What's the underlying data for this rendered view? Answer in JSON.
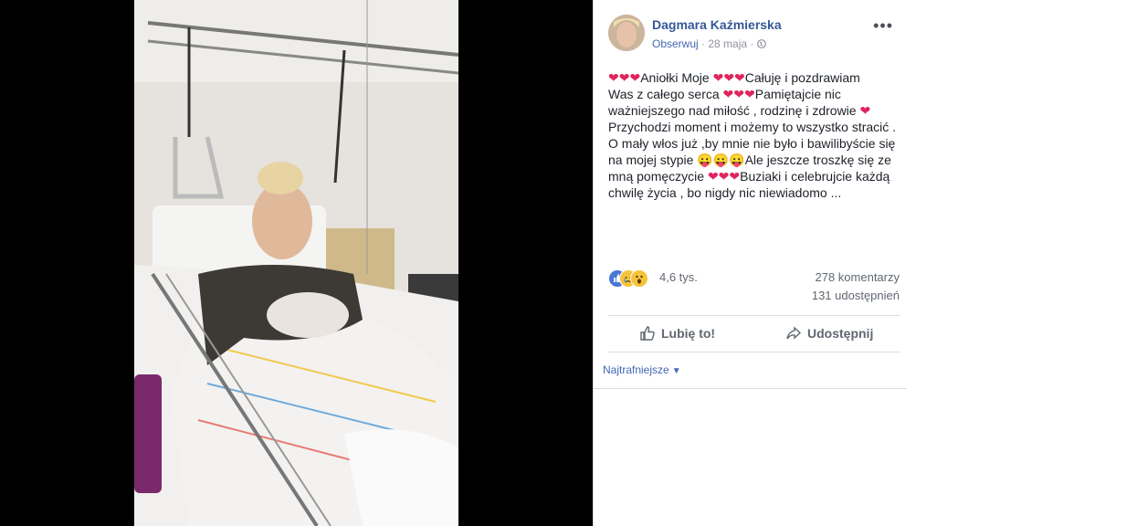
{
  "post": {
    "author": "Dagmara Kaźmierska",
    "follow_label": "Obserwuj",
    "date": "28 maja",
    "separator": " · ",
    "more_label": "•••",
    "text_lines": [
      {
        "parts": [
          {
            "t": "heart"
          },
          {
            "t": "heart"
          },
          {
            "t": "heart"
          },
          {
            "t": "text",
            "v": "Aniołki Moje "
          },
          {
            "t": "heart"
          },
          {
            "t": "heart"
          },
          {
            "t": "heart"
          },
          {
            "t": "text",
            "v": "Całuję i pozdrawiam"
          }
        ]
      },
      {
        "parts": [
          {
            "t": "text",
            "v": "Was z całego serca "
          },
          {
            "t": "heart"
          },
          {
            "t": "heart"
          },
          {
            "t": "heart"
          },
          {
            "t": "text",
            "v": "Pamiętajcie nic"
          }
        ]
      },
      {
        "parts": [
          {
            "t": "text",
            "v": "ważniejszego nad miłość , rodzinę i zdrowie "
          },
          {
            "t": "heart"
          }
        ]
      },
      {
        "parts": [
          {
            "t": "text",
            "v": "Przychodzi moment i możemy to wszystko stracić ."
          }
        ]
      },
      {
        "parts": [
          {
            "t": "text",
            "v": "O mały włos już ,by mnie nie było i bawilibyście się"
          }
        ]
      },
      {
        "parts": [
          {
            "t": "text",
            "v": "na mojej stypie "
          },
          {
            "t": "emoji",
            "v": "😛😛😛"
          },
          {
            "t": "text",
            "v": "Ale jeszcze troszkę się ze"
          }
        ]
      },
      {
        "parts": [
          {
            "t": "text",
            "v": "mną pomęczycie "
          },
          {
            "t": "heart"
          },
          {
            "t": "heart"
          },
          {
            "t": "heart"
          },
          {
            "t": "text",
            "v": "Buziaki i celebrujcie każdą"
          }
        ]
      },
      {
        "parts": [
          {
            "t": "text",
            "v": "chwilę życia , bo nigdy nic niewiadomo ..."
          }
        ]
      }
    ],
    "heart_glyph": "❤",
    "reactions": {
      "icons": [
        "like-icon",
        "sad-icon",
        "wow-icon"
      ],
      "count": "4,6 tys."
    },
    "comments_count": "278 komentarzy",
    "shares_count": "131 udostępnień",
    "like_label": "Lubię to!",
    "share_label": "Udostępnij",
    "sort_label": "Najtrafniejsze",
    "colors": {
      "link": "#365899",
      "heart": "#e0245e",
      "text": "#1d2129",
      "muted": "#90949c"
    }
  }
}
